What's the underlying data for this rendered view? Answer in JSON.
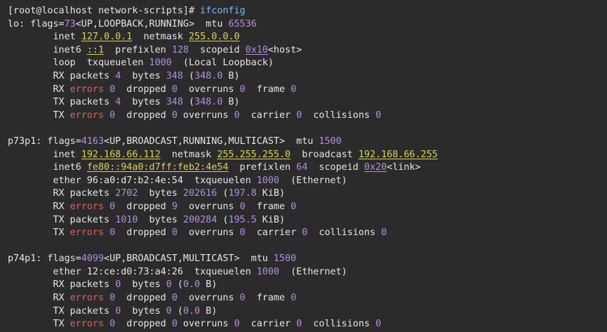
{
  "terminal": {
    "lines": [
      {
        "segments": [
          {
            "t": "[root@localhost network-scripts]# ",
            "c": "prompt"
          },
          {
            "t": "ifconfig",
            "c": "cmd"
          }
        ]
      },
      {
        "segments": [
          {
            "t": "lo: flags=",
            "c": "plain"
          },
          {
            "t": "73",
            "c": "num"
          },
          {
            "t": "<UP,LOOPBACK,RUNNING>",
            "c": "plain"
          },
          {
            "t": "  mtu ",
            "c": "plain"
          },
          {
            "t": "65536",
            "c": "num"
          }
        ]
      },
      {
        "segments": [
          {
            "t": "        inet ",
            "c": "plain"
          },
          {
            "t": "127.0.0.1",
            "c": "addr"
          },
          {
            "t": "  netmask ",
            "c": "plain"
          },
          {
            "t": "255.0.0.0",
            "c": "addr"
          }
        ]
      },
      {
        "segments": [
          {
            "t": "        inet6 ",
            "c": "plain"
          },
          {
            "t": "::1",
            "c": "addr"
          },
          {
            "t": "  prefixlen ",
            "c": "plain"
          },
          {
            "t": "128",
            "c": "num"
          },
          {
            "t": "  scopeid ",
            "c": "plain"
          },
          {
            "t": "0x10",
            "c": "hexid"
          },
          {
            "t": "<host>",
            "c": "plain"
          }
        ]
      },
      {
        "segments": [
          {
            "t": "        loop  txqueuelen ",
            "c": "plain"
          },
          {
            "t": "1000",
            "c": "num"
          },
          {
            "t": "  (Local Loopback)",
            "c": "plain"
          }
        ]
      },
      {
        "segments": [
          {
            "t": "        RX packets ",
            "c": "plain"
          },
          {
            "t": "4",
            "c": "num"
          },
          {
            "t": "  bytes ",
            "c": "plain"
          },
          {
            "t": "348",
            "c": "num"
          },
          {
            "t": " (",
            "c": "plain"
          },
          {
            "t": "348.0",
            "c": "num"
          },
          {
            "t": " B)",
            "c": "plain"
          }
        ]
      },
      {
        "segments": [
          {
            "t": "        RX ",
            "c": "plain"
          },
          {
            "t": "errors",
            "c": "err"
          },
          {
            "t": " ",
            "c": "plain"
          },
          {
            "t": "0",
            "c": "num"
          },
          {
            "t": "  dropped ",
            "c": "plain"
          },
          {
            "t": "0",
            "c": "num"
          },
          {
            "t": "  overruns ",
            "c": "plain"
          },
          {
            "t": "0",
            "c": "num"
          },
          {
            "t": "  frame ",
            "c": "plain"
          },
          {
            "t": "0",
            "c": "num"
          }
        ]
      },
      {
        "segments": [
          {
            "t": "        TX packets ",
            "c": "plain"
          },
          {
            "t": "4",
            "c": "num"
          },
          {
            "t": "  bytes ",
            "c": "plain"
          },
          {
            "t": "348",
            "c": "num"
          },
          {
            "t": " (",
            "c": "plain"
          },
          {
            "t": "348.0",
            "c": "num"
          },
          {
            "t": " B)",
            "c": "plain"
          }
        ]
      },
      {
        "segments": [
          {
            "t": "        TX ",
            "c": "plain"
          },
          {
            "t": "errors",
            "c": "err"
          },
          {
            "t": " ",
            "c": "plain"
          },
          {
            "t": "0",
            "c": "num"
          },
          {
            "t": "  dropped ",
            "c": "plain"
          },
          {
            "t": "0",
            "c": "num"
          },
          {
            "t": " overruns ",
            "c": "plain"
          },
          {
            "t": "0",
            "c": "num"
          },
          {
            "t": "  carrier ",
            "c": "plain"
          },
          {
            "t": "0",
            "c": "num"
          },
          {
            "t": "  collisions ",
            "c": "plain"
          },
          {
            "t": "0",
            "c": "num"
          }
        ]
      },
      {
        "segments": [
          {
            "t": "",
            "c": "plain"
          }
        ]
      },
      {
        "segments": [
          {
            "t": "p73p1: flags=",
            "c": "plain"
          },
          {
            "t": "4163",
            "c": "num"
          },
          {
            "t": "<UP,BROADCAST,RUNNING,MULTICAST>",
            "c": "plain"
          },
          {
            "t": "  mtu ",
            "c": "plain"
          },
          {
            "t": "1500",
            "c": "num"
          }
        ]
      },
      {
        "segments": [
          {
            "t": "        inet ",
            "c": "plain"
          },
          {
            "t": "192.168.66.112",
            "c": "addr"
          },
          {
            "t": "  netmask ",
            "c": "plain"
          },
          {
            "t": "255.255.255.0",
            "c": "addr"
          },
          {
            "t": "  broadcast ",
            "c": "plain"
          },
          {
            "t": "192.168.66.255",
            "c": "addr"
          }
        ]
      },
      {
        "segments": [
          {
            "t": "        inet6 ",
            "c": "plain"
          },
          {
            "t": "fe80::94a0:d7ff:feb2:4e54",
            "c": "addr"
          },
          {
            "t": "  prefixlen ",
            "c": "plain"
          },
          {
            "t": "64",
            "c": "num"
          },
          {
            "t": "  scopeid ",
            "c": "plain"
          },
          {
            "t": "0x20",
            "c": "hexid"
          },
          {
            "t": "<link>",
            "c": "plain"
          }
        ]
      },
      {
        "segments": [
          {
            "t": "        ether ",
            "c": "plain"
          },
          {
            "t": "96:a0:d7:b2:4e:54",
            "c": "plain"
          },
          {
            "t": "  txqueuelen ",
            "c": "plain"
          },
          {
            "t": "1000",
            "c": "num"
          },
          {
            "t": "  (Ethernet)",
            "c": "plain"
          }
        ]
      },
      {
        "segments": [
          {
            "t": "        RX packets ",
            "c": "plain"
          },
          {
            "t": "2702",
            "c": "num"
          },
          {
            "t": "  bytes ",
            "c": "plain"
          },
          {
            "t": "202616",
            "c": "num"
          },
          {
            "t": " (",
            "c": "plain"
          },
          {
            "t": "197.8",
            "c": "num"
          },
          {
            "t": " KiB)",
            "c": "plain"
          }
        ]
      },
      {
        "segments": [
          {
            "t": "        RX ",
            "c": "plain"
          },
          {
            "t": "errors",
            "c": "err"
          },
          {
            "t": " ",
            "c": "plain"
          },
          {
            "t": "0",
            "c": "num"
          },
          {
            "t": "  dropped ",
            "c": "plain"
          },
          {
            "t": "9",
            "c": "num"
          },
          {
            "t": "  overruns ",
            "c": "plain"
          },
          {
            "t": "0",
            "c": "num"
          },
          {
            "t": "  frame ",
            "c": "plain"
          },
          {
            "t": "0",
            "c": "num"
          }
        ]
      },
      {
        "segments": [
          {
            "t": "        TX packets ",
            "c": "plain"
          },
          {
            "t": "1010",
            "c": "num"
          },
          {
            "t": "  bytes ",
            "c": "plain"
          },
          {
            "t": "200284",
            "c": "num"
          },
          {
            "t": " (",
            "c": "plain"
          },
          {
            "t": "195.5",
            "c": "num"
          },
          {
            "t": " KiB)",
            "c": "plain"
          }
        ]
      },
      {
        "segments": [
          {
            "t": "        TX ",
            "c": "plain"
          },
          {
            "t": "errors",
            "c": "err"
          },
          {
            "t": " ",
            "c": "plain"
          },
          {
            "t": "0",
            "c": "num"
          },
          {
            "t": "  dropped ",
            "c": "plain"
          },
          {
            "t": "0",
            "c": "num"
          },
          {
            "t": "  overruns ",
            "c": "plain"
          },
          {
            "t": "0",
            "c": "num"
          },
          {
            "t": "  carrier ",
            "c": "plain"
          },
          {
            "t": "0",
            "c": "num"
          },
          {
            "t": "  collisions ",
            "c": "plain"
          },
          {
            "t": "0",
            "c": "num"
          }
        ]
      },
      {
        "segments": [
          {
            "t": "",
            "c": "plain"
          }
        ]
      },
      {
        "segments": [
          {
            "t": "p74p1: flags=",
            "c": "plain"
          },
          {
            "t": "4099",
            "c": "num"
          },
          {
            "t": "<UP,BROADCAST,MULTICAST>",
            "c": "plain"
          },
          {
            "t": "  mtu ",
            "c": "plain"
          },
          {
            "t": "1500",
            "c": "num"
          }
        ]
      },
      {
        "segments": [
          {
            "t": "        ether ",
            "c": "plain"
          },
          {
            "t": "12:ce:d0:73:a4:26",
            "c": "plain"
          },
          {
            "t": "  txqueuelen ",
            "c": "plain"
          },
          {
            "t": "1000",
            "c": "num"
          },
          {
            "t": "  (Ethernet)",
            "c": "plain"
          }
        ]
      },
      {
        "segments": [
          {
            "t": "        RX packets ",
            "c": "plain"
          },
          {
            "t": "0",
            "c": "num"
          },
          {
            "t": "  bytes ",
            "c": "plain"
          },
          {
            "t": "0",
            "c": "num"
          },
          {
            "t": " (",
            "c": "plain"
          },
          {
            "t": "0.0",
            "c": "num"
          },
          {
            "t": " B)",
            "c": "plain"
          }
        ]
      },
      {
        "segments": [
          {
            "t": "        RX ",
            "c": "plain"
          },
          {
            "t": "errors",
            "c": "err"
          },
          {
            "t": " ",
            "c": "plain"
          },
          {
            "t": "0",
            "c": "num"
          },
          {
            "t": "  dropped ",
            "c": "plain"
          },
          {
            "t": "0",
            "c": "num"
          },
          {
            "t": "  overruns ",
            "c": "plain"
          },
          {
            "t": "0",
            "c": "num"
          },
          {
            "t": "  frame ",
            "c": "plain"
          },
          {
            "t": "0",
            "c": "num"
          }
        ]
      },
      {
        "segments": [
          {
            "t": "        TX packets ",
            "c": "plain"
          },
          {
            "t": "0",
            "c": "num"
          },
          {
            "t": "  bytes ",
            "c": "plain"
          },
          {
            "t": "0",
            "c": "num"
          },
          {
            "t": " (",
            "c": "plain"
          },
          {
            "t": "0.0",
            "c": "num"
          },
          {
            "t": " B)",
            "c": "plain"
          }
        ]
      },
      {
        "segments": [
          {
            "t": "        TX ",
            "c": "plain"
          },
          {
            "t": "errors",
            "c": "err"
          },
          {
            "t": " ",
            "c": "plain"
          },
          {
            "t": "0",
            "c": "num"
          },
          {
            "t": "  dropped ",
            "c": "plain"
          },
          {
            "t": "0",
            "c": "num"
          },
          {
            "t": " overruns ",
            "c": "plain"
          },
          {
            "t": "0",
            "c": "num"
          },
          {
            "t": "  carrier ",
            "c": "plain"
          },
          {
            "t": "0",
            "c": "num"
          },
          {
            "t": "  collisions ",
            "c": "plain"
          },
          {
            "t": "0",
            "c": "num"
          }
        ]
      }
    ]
  },
  "colors": {
    "background": "#2b2b2b",
    "text": "#e6e6e6",
    "number": "#b48ee0",
    "address": "#d9d25a",
    "error": "#e35f5f",
    "command": "#7fb7ff"
  }
}
